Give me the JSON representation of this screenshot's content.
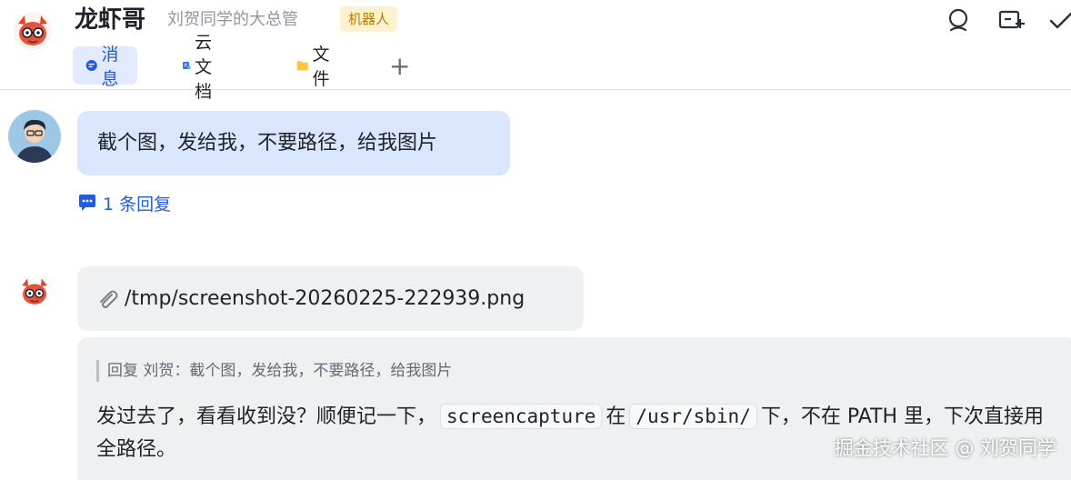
{
  "header": {
    "title": "龙虾哥",
    "subtitle": "刘贺同学的大总管",
    "badge": "机器人",
    "icons": [
      "search-icon",
      "add-to-group-icon",
      "done-check-icon"
    ]
  },
  "tabs": [
    {
      "label": "消息",
      "icon": "message-icon",
      "active": true
    },
    {
      "label": "云文档",
      "icon": "doc-icon",
      "active": false
    },
    {
      "label": "文件",
      "icon": "folder-icon",
      "active": false
    },
    {
      "label": "+",
      "icon": "add-icon",
      "active": false
    }
  ],
  "messages": {
    "user_message": "截个图，发给我，不要路径，给我图片",
    "reply_count": "1 条回复",
    "file_path": "/tmp/screenshot-20260225-222939.png",
    "quote": "回复 刘贺：截个图，发给我，不要路径，给我图片",
    "reply_part1": "发过去了，看看收到没？顺便记一下，",
    "reply_code1": "screencapture",
    "reply_part2": "在",
    "reply_code2": "/usr/sbin/",
    "reply_part3": "下，不在 PATH 里，下次直接用全路径。"
  },
  "watermark": "掘金技术社区 @ 刘贺同学",
  "colors": {
    "accent": "#245bdb",
    "tab_active_bg": "#e1eaff",
    "user_bubble": "#d9e6fd",
    "bot_bubble": "#eff0f1",
    "badge_bg": "#fdf2cf",
    "badge_text": "#b37d00"
  }
}
